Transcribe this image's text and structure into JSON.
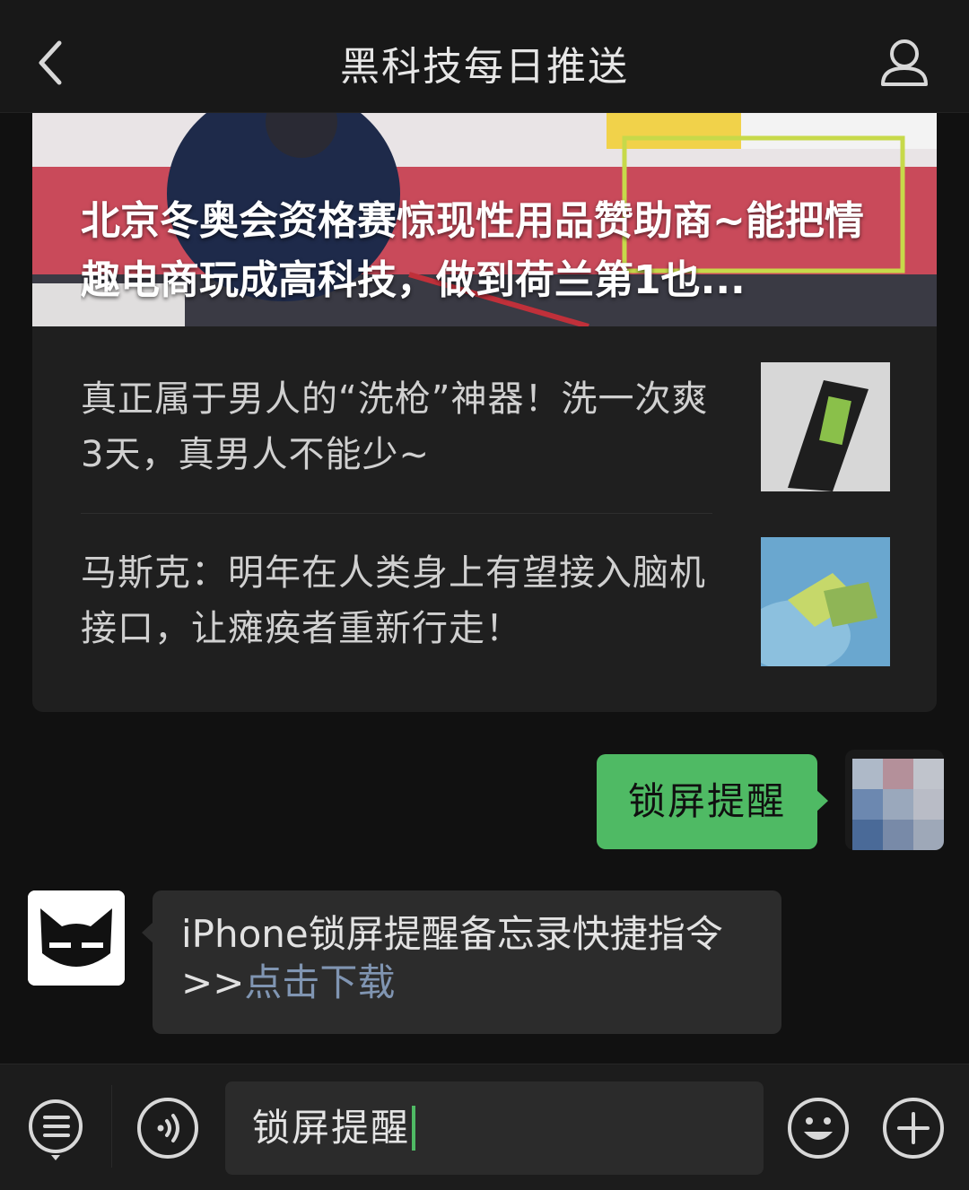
{
  "header": {
    "title": "黑科技每日推送"
  },
  "articles": {
    "main_title": "北京冬奥会资格赛惊现性用品赞助商~能把情趣电商玩成高科技，做到荷兰第1也...",
    "items": [
      {
        "title": "真正属于男人的“洗枪”神器！洗一次爽3天，真男人不能少~"
      },
      {
        "title": "马斯克：明年在人类身上有望接入脑机接口，让瘫痪者重新行走！"
      }
    ]
  },
  "messages": {
    "sent_text": "锁屏提醒",
    "received_text": "iPhone锁屏提醒备忘录快捷指令",
    "received_prefix": ">>",
    "received_link": "点击下载"
  },
  "input": {
    "value": "锁屏提醒"
  },
  "colors": {
    "accent_green": "#4fba64",
    "link_blue": "#8095b2",
    "background": "#111111"
  },
  "icons": [
    "back-chevron-icon",
    "user-icon",
    "menu-list-icon",
    "voice-icon",
    "emoji-icon",
    "plus-icon"
  ]
}
